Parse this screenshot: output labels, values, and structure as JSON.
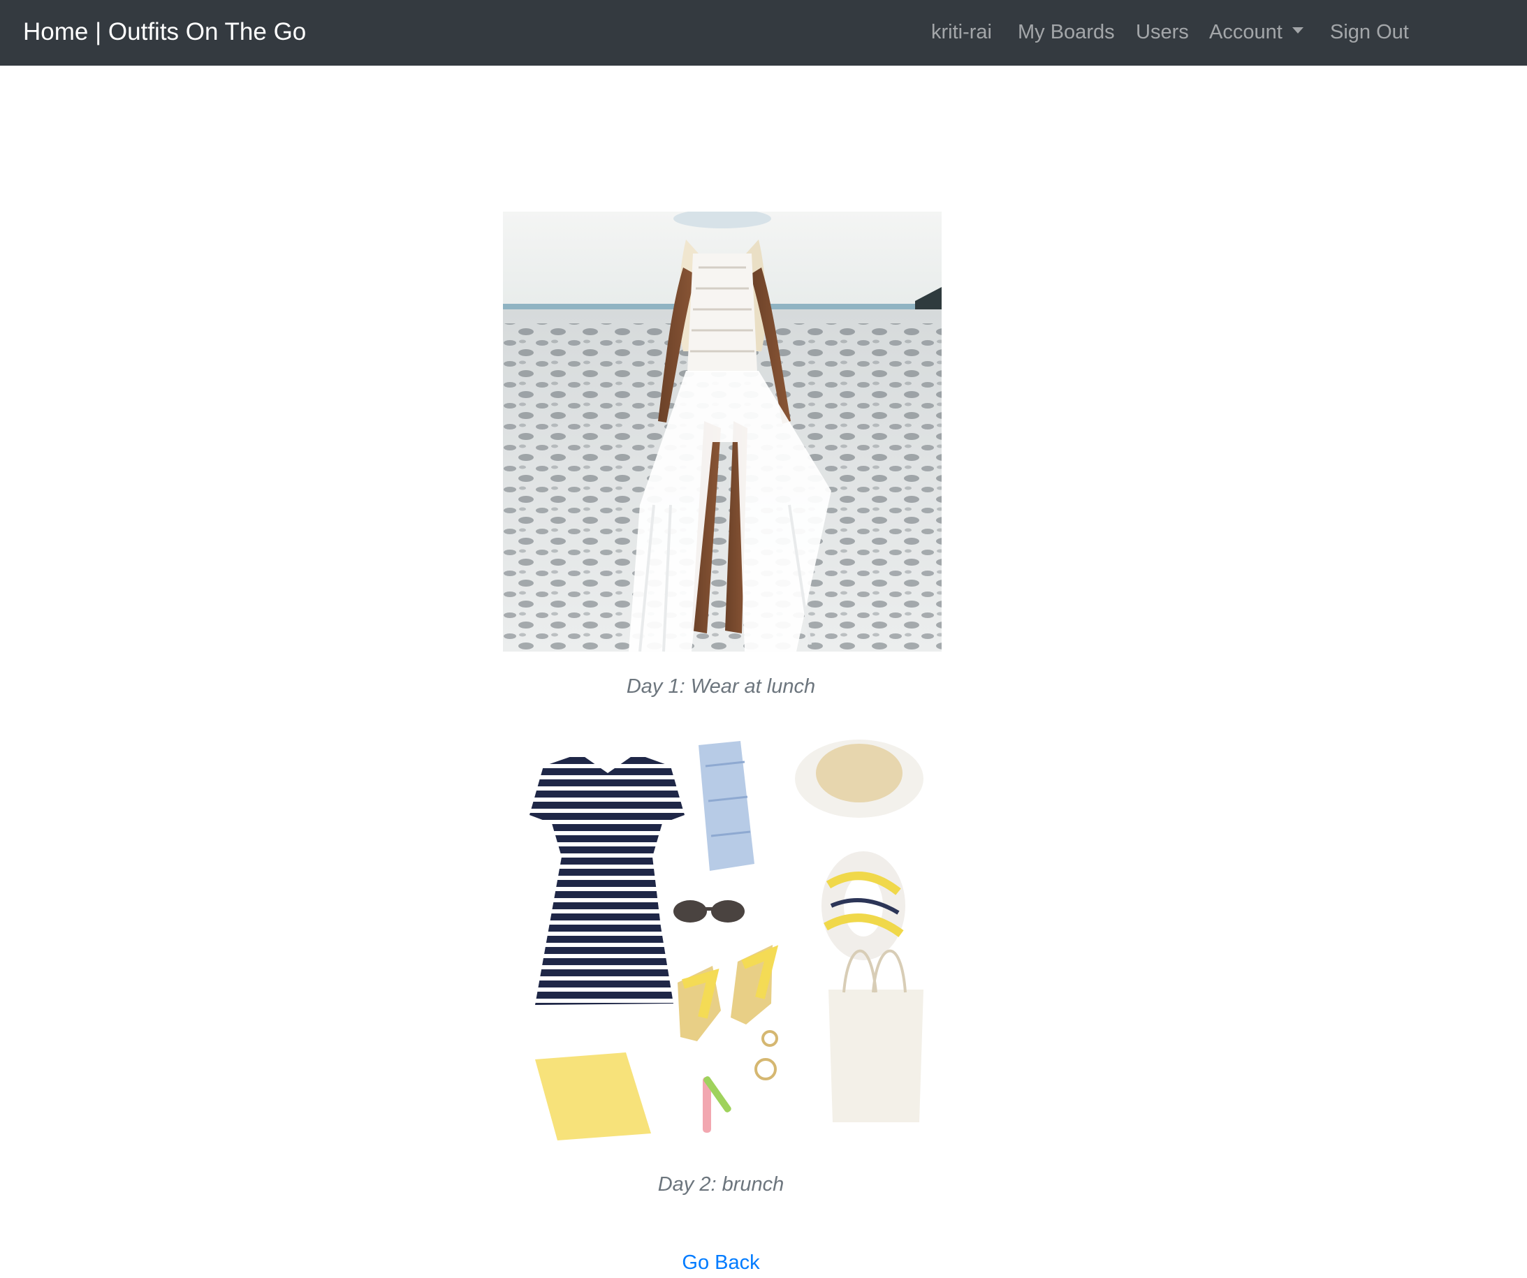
{
  "navbar": {
    "brand": "Home | Outfits On The Go",
    "links": {
      "user": "kriti-rai",
      "my_boards": "My Boards",
      "users": "Users",
      "account": "Account",
      "sign_out": "Sign Out"
    }
  },
  "colors": {
    "navbar_bg": "#343a40",
    "link": "#007bff",
    "caption": "#6c757d"
  },
  "outfits": [
    {
      "caption": "Day 1: Wear at lunch"
    },
    {
      "caption": "Day 2: brunch"
    }
  ],
  "go_back": "Go Back"
}
